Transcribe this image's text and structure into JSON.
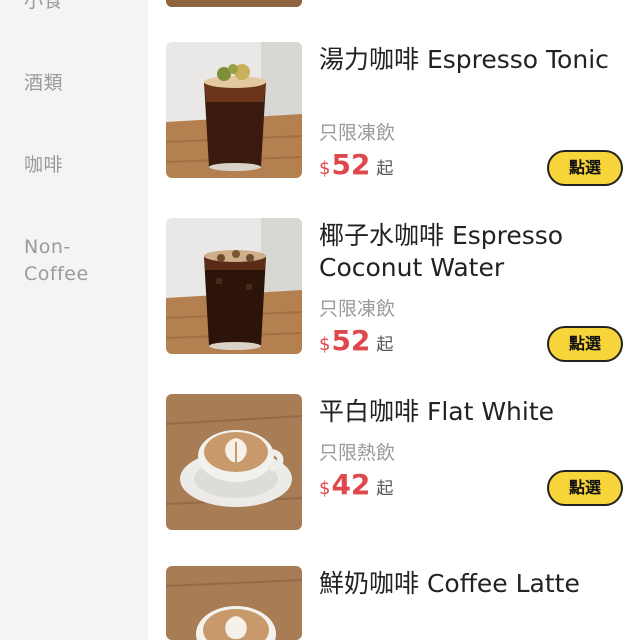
{
  "sidebar": {
    "items": [
      {
        "label": "小食",
        "icon": ""
      },
      {
        "label": "酒類"
      },
      {
        "label": "咖啡"
      },
      {
        "label": "Non-\nCoffee"
      }
    ]
  },
  "menu": {
    "currency": "$",
    "select_label": "點選",
    "price_suffix": "起",
    "items": [
      {
        "name": "湯力咖啡 Espresso Tonic",
        "note": "只限凍飲",
        "price": "52",
        "image_icon": "iced-tonic-drink"
      },
      {
        "name": "椰子水咖啡 Espresso Coconut Water",
        "note": "只限凍飲",
        "price": "52",
        "image_icon": "iced-coconut-drink"
      },
      {
        "name": "平白咖啡 Flat White",
        "note": "只限熱飲",
        "price": "42",
        "image_icon": "latte-art-cup"
      },
      {
        "name": "鮮奶咖啡 Coffee Latte",
        "note": "",
        "price": "",
        "image_icon": "latte-art-cup"
      }
    ]
  },
  "colors": {
    "sidebar_bg": "#f4f4f4",
    "price": "#e0474c",
    "button": "#f6d43a",
    "button_border": "#222222"
  }
}
